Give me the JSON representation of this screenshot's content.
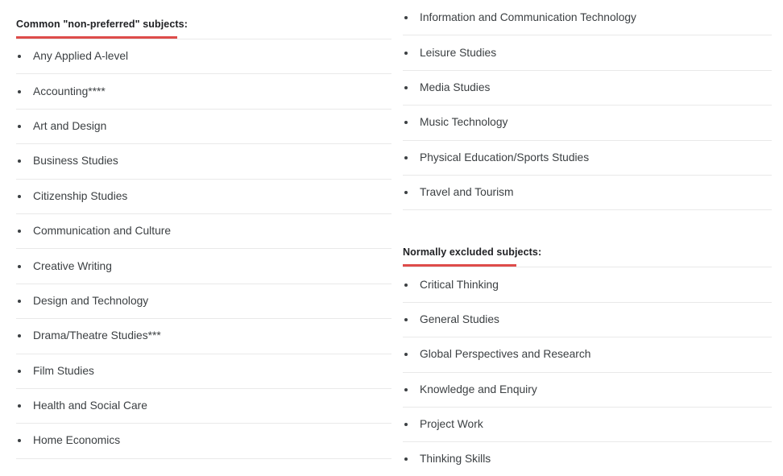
{
  "page": {
    "background_color": "#ffffff",
    "accent_color": "#de4c4a",
    "text_color": "#3c4043",
    "heading_color": "#202124",
    "divider_color": "#e9e9e9"
  },
  "left_column": {
    "heading": {
      "title": "Common \"non-preferred\" subjects:",
      "underline_color": "#de4c4a"
    },
    "items": [
      {
        "label": "Any Applied A-level"
      },
      {
        "label": "Accounting****"
      },
      {
        "label": "Art and Design"
      },
      {
        "label": "Business Studies"
      },
      {
        "label": "Citizenship Studies"
      },
      {
        "label": "Communication and Culture"
      },
      {
        "label": "Creative Writing"
      },
      {
        "label": "Design and Technology"
      },
      {
        "label": "Drama/Theatre Studies***"
      },
      {
        "label": "Film Studies"
      },
      {
        "label": "Health and Social Care"
      },
      {
        "label": "Home Economics"
      }
    ]
  },
  "right_column": {
    "continued_items": [
      {
        "label": "Information and Communication Technology"
      },
      {
        "label": "Leisure Studies"
      },
      {
        "label": "Media Studies"
      },
      {
        "label": "Music Technology"
      },
      {
        "label": "Physical Education/Sports Studies"
      },
      {
        "label": "Travel and Tourism"
      }
    ],
    "heading": {
      "title": "Normally excluded subjects:",
      "underline_color": "#de4c4a"
    },
    "excluded_items": [
      {
        "label": "Critical Thinking"
      },
      {
        "label": "General Studies"
      },
      {
        "label": "Global Perspectives and Research"
      },
      {
        "label": "Knowledge and Enquiry"
      },
      {
        "label": "Project Work"
      },
      {
        "label": "Thinking Skills"
      }
    ]
  }
}
